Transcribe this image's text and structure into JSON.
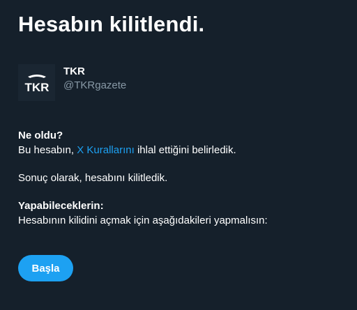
{
  "page": {
    "title": "Hesabın kilitlendi."
  },
  "account": {
    "name": "TKR",
    "handle": "@TKRgazete",
    "logo_text": "TKR"
  },
  "what_happened": {
    "heading": "Ne oldu?",
    "text_before_link": "Bu hesabın, ",
    "link_label": "X Kurallarını",
    "text_after_link": " ihlal ettiğini belirledik."
  },
  "result": {
    "text": "Sonuç olarak, hesabını kilitledik."
  },
  "what_you_can_do": {
    "heading": "Yapabileceklerin:",
    "text": "Hesabının kilidini açmak için aşağıdakileri yapmalısın:"
  },
  "actions": {
    "start_label": "Başla"
  },
  "colors": {
    "background": "#15202b",
    "accent": "#1da1f2",
    "secondary_text": "#8899a6"
  }
}
